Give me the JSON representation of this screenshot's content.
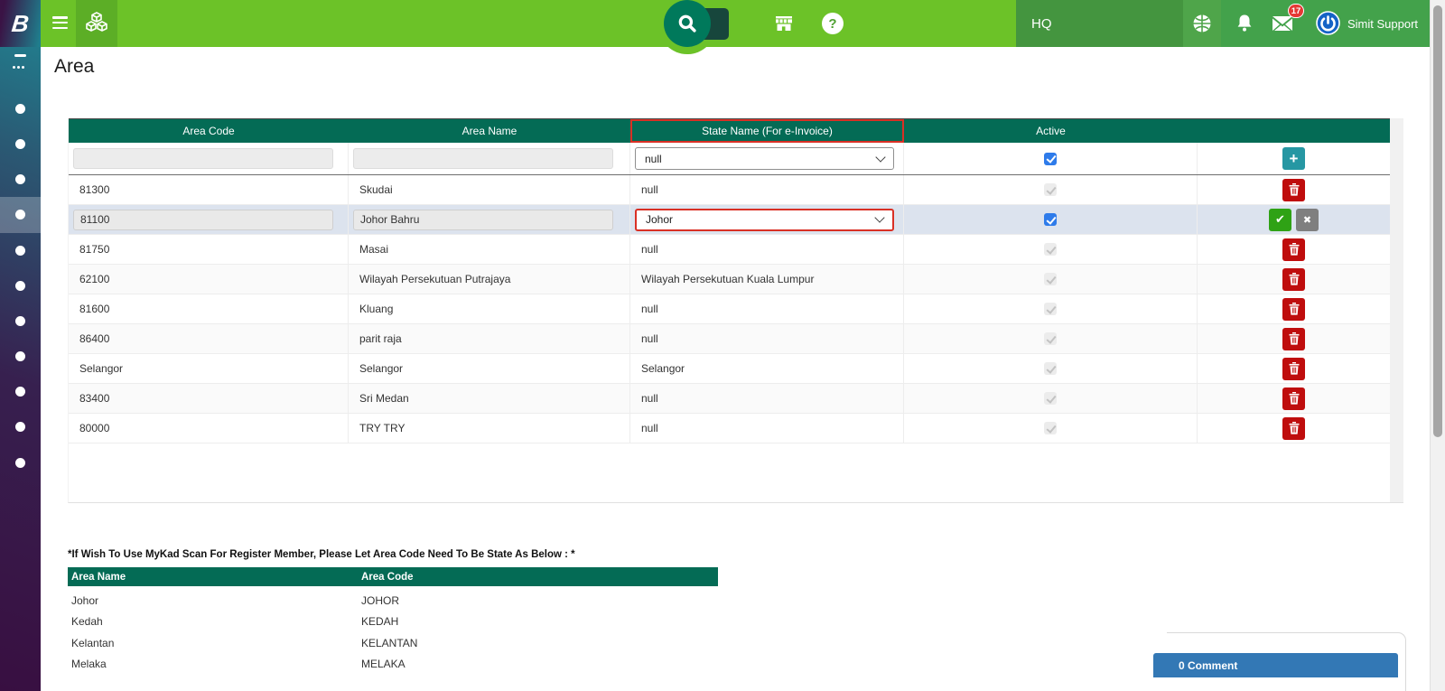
{
  "topbar": {
    "brand": "B",
    "branch": "HQ",
    "user": "Simit Support",
    "mail_badge": "17",
    "help_glyph": "?"
  },
  "page": {
    "title": "Area"
  },
  "icons": {
    "add": "+",
    "confirm": "✔",
    "cancel": "✖"
  },
  "main_table": {
    "headers": [
      "Area Code",
      "Area Name",
      "State Name (For e-Invoice)",
      "Active"
    ],
    "filter": {
      "state": "null"
    },
    "rows": [
      {
        "code": "81300",
        "name": "Skudai",
        "state": "null"
      },
      {
        "code": "81100",
        "name": "Johor Bahru",
        "state": "Johor"
      },
      {
        "code": "81750",
        "name": "Masai",
        "state": "null"
      },
      {
        "code": "62100",
        "name": "Wilayah Persekutuan Putrajaya",
        "state": "Wilayah Persekutuan Kuala Lumpur"
      },
      {
        "code": "81600",
        "name": "Kluang",
        "state": "null"
      },
      {
        "code": "86400",
        "name": "parit raja",
        "state": "null"
      },
      {
        "code": "Selangor",
        "name": "Selangor",
        "state": "Selangor"
      },
      {
        "code": "83400",
        "name": "Sri Medan",
        "state": "null"
      },
      {
        "code": "80000",
        "name": "TRY TRY",
        "state": "null"
      }
    ]
  },
  "mykad": {
    "note": "*If Wish To Use MyKad Scan For Register Member, Please Let Area Code Need To Be State As Below : *",
    "headers": [
      "Area Name",
      "Area Code"
    ],
    "rows": [
      {
        "name": "Johor",
        "code": "JOHOR"
      },
      {
        "name": "Kedah",
        "code": "KEDAH"
      },
      {
        "name": "Kelantan",
        "code": "KELANTAN"
      },
      {
        "name": "Melaka",
        "code": "MELAKA"
      }
    ]
  },
  "comments": {
    "label": "0 Comment"
  },
  "colors": {
    "topbar_green": "#6CC228",
    "table_header_teal": "#046B55",
    "highlight_red": "#D93025",
    "edit_row_bg": "#DCE3EE",
    "comment_blue": "#3378B5",
    "checkbox_blue": "#2E7BEA"
  }
}
